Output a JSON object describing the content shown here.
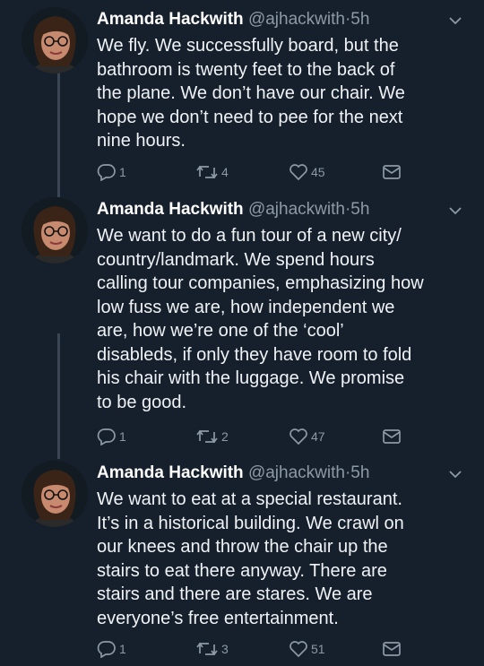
{
  "tweets": [
    {
      "author": {
        "name": "Amanda Hackwith",
        "handle": "@ajhackwith",
        "separator": "·",
        "time": "5h"
      },
      "lines": [
        "We fly. We successfully board, but the",
        "bathroom is twenty feet to the back of",
        "the plane. We don’t have our chair. We",
        "hope we don’t need to pee for the next",
        "nine hours."
      ],
      "stats": {
        "replies": "1",
        "retweets": "4",
        "likes": "45"
      }
    },
    {
      "author": {
        "name": "Amanda Hackwith",
        "handle": "@ajhackwith",
        "separator": "·",
        "time": "5h"
      },
      "lines": [
        "We want to do a fun tour of a new city/",
        "country/landmark. We spend hours",
        "calling tour companies, emphasizing how",
        "low fuss we are, how independent we",
        "are, how we’re one of the ‘cool’",
        "disableds, if only they have room to fold",
        "his chair with the luggage. We promise",
        "to be good."
      ],
      "stats": {
        "replies": "1",
        "retweets": "2",
        "likes": "47"
      }
    },
    {
      "author": {
        "name": "Amanda Hackwith",
        "handle": "@ajhackwith",
        "separator": "·",
        "time": "5h"
      },
      "lines": [
        "We want to eat at a special restaurant.",
        "It’s in a historical building. We crawl on",
        "our knees and throw the chair up the",
        "stairs to eat there anyway. There are",
        "stairs and there are stares. We are",
        "everyone’s free entertainment."
      ],
      "stats": {
        "replies": "1",
        "retweets": "3",
        "likes": "51"
      }
    }
  ],
  "icons": {
    "reply": "reply-icon",
    "retweet": "retweet-icon",
    "like": "heart-icon",
    "message": "envelope-icon",
    "menu": "chevron-down-icon"
  },
  "colors": {
    "background": "#16202c",
    "text": "#f0f3f6",
    "muted": "#8d99a6",
    "thread_line": "#3a4654"
  }
}
